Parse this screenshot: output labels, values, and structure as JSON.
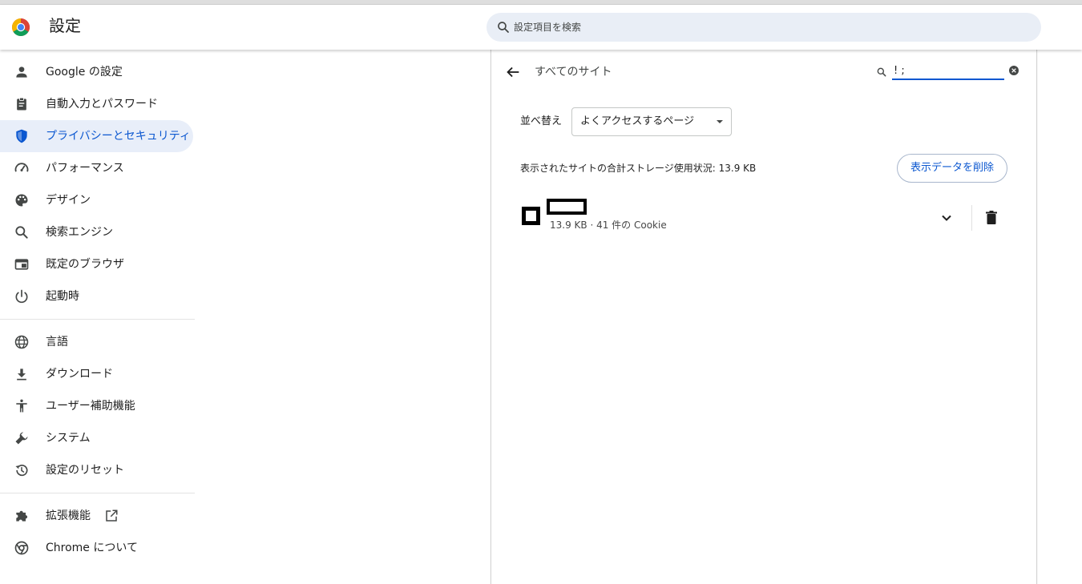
{
  "header": {
    "title": "設定",
    "search_placeholder": "設定項目を検索"
  },
  "sidebar": {
    "items": [
      {
        "label": "Google の設定",
        "icon": "person-icon"
      },
      {
        "label": "自動入力とパスワード",
        "icon": "clipboard-icon"
      },
      {
        "label": "プライバシーとセキュリティ",
        "icon": "shield-icon",
        "active": true
      },
      {
        "label": "パフォーマンス",
        "icon": "speedometer-icon"
      },
      {
        "label": "デザイン",
        "icon": "palette-icon"
      },
      {
        "label": "検索エンジン",
        "icon": "search-icon"
      },
      {
        "label": "既定のブラウザ",
        "icon": "browser-window-icon"
      },
      {
        "label": "起動時",
        "icon": "power-icon"
      },
      {
        "label": "言語",
        "icon": "globe-icon"
      },
      {
        "label": "ダウンロード",
        "icon": "download-icon"
      },
      {
        "label": "ユーザー補助機能",
        "icon": "accessibility-icon"
      },
      {
        "label": "システム",
        "icon": "wrench-icon"
      },
      {
        "label": "設定のリセット",
        "icon": "history-icon"
      },
      {
        "label": "拡張機能",
        "icon": "puzzle-icon"
      },
      {
        "label": "Chrome について",
        "icon": "chrome-icon"
      }
    ]
  },
  "main": {
    "page_title": "すべてのサイト",
    "site_search_value": "! ;",
    "sort_label": "並べ替え",
    "sort_value": "よくアクセスするページ",
    "storage_usage": "表示されたサイトの合計ストレージ使用状況: 13.9 KB",
    "clear_data_label": "表示データを削除",
    "site": {
      "meta": "13.9 KB · 41 件の Cookie"
    }
  },
  "colors": {
    "accent": "#0b57d0",
    "active_nav_bg": "#e8eef9",
    "search_bg": "#e9eef6"
  }
}
